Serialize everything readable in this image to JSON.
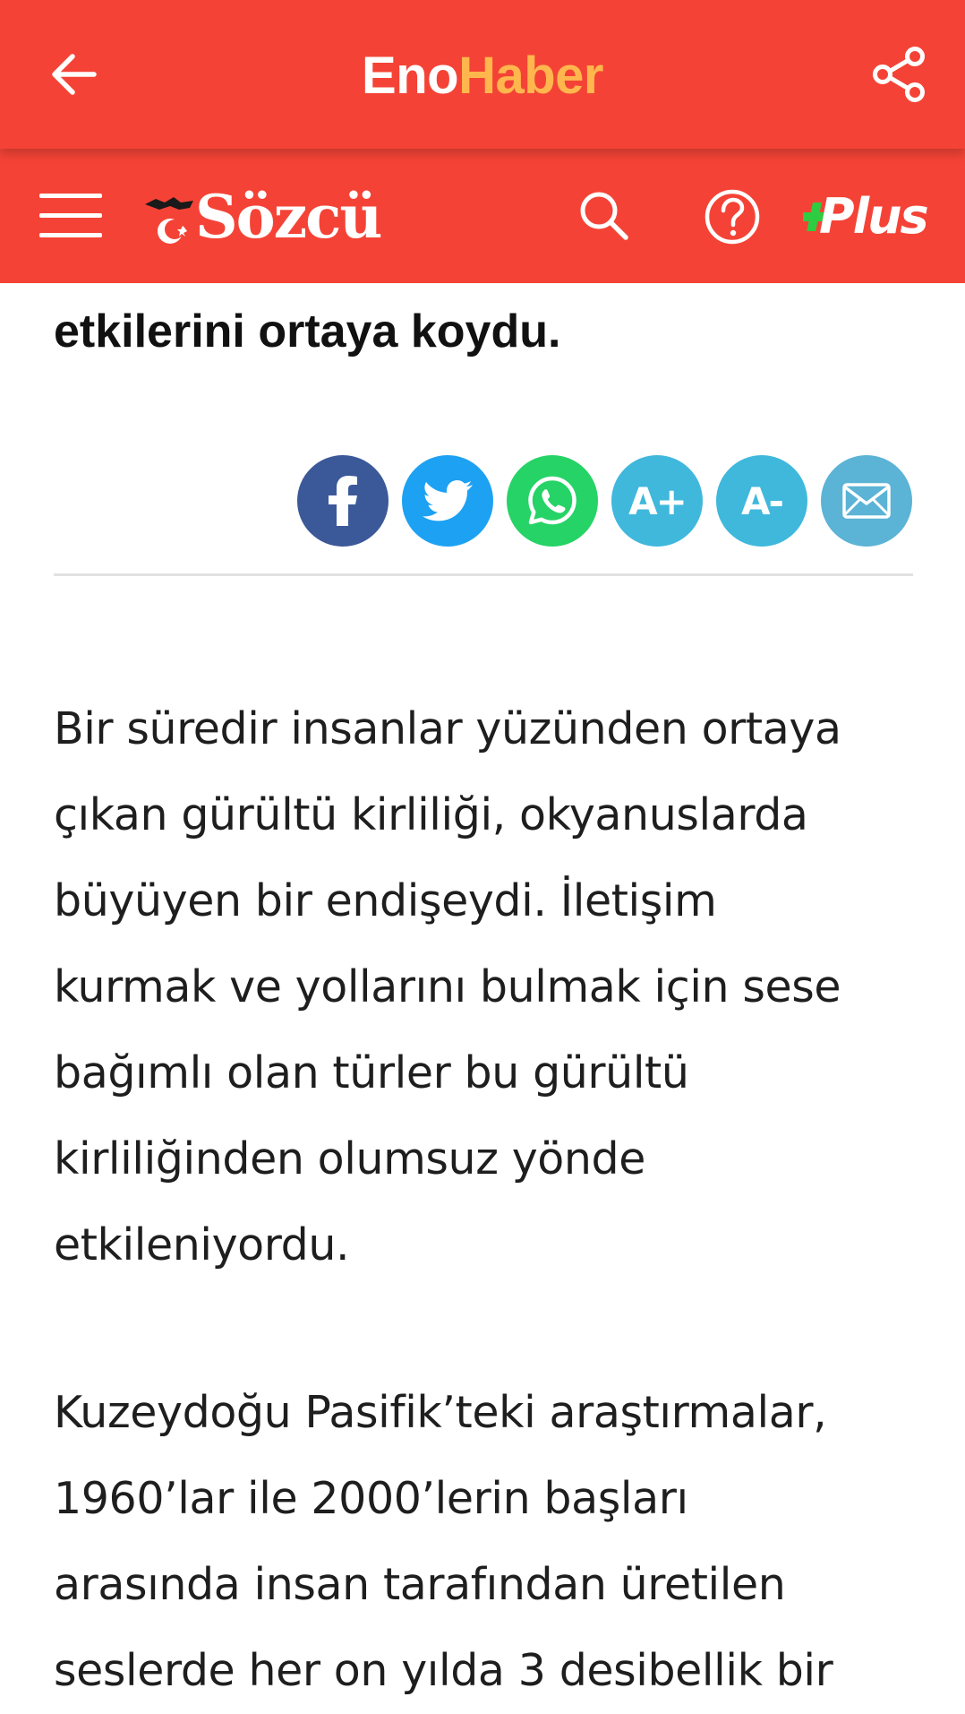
{
  "app_bar": {
    "title_part1": "Eno",
    "title_part2": "Haber",
    "back_icon": "arrow-left-icon",
    "share_icon": "share-icon"
  },
  "site_header": {
    "logo_text": "Sözcü",
    "menu_icon": "hamburger-menu-icon",
    "search_icon": "search-icon",
    "help_icon": "help-circle-icon",
    "plus_label": "Plus"
  },
  "article": {
    "headline_tail": "etkilerini ortaya koydu.",
    "share_buttons": {
      "facebook_icon": "facebook-icon",
      "twitter_icon": "twitter-icon",
      "whatsapp_icon": "whatsapp-icon",
      "font_increase_label": "A+",
      "font_decrease_label": "A-",
      "email_icon": "email-icon"
    },
    "paragraph_1_lines": [
      "Bir süredir insanlar yüzünden ortaya",
      "çıkan gürültü kirliliği, okyanuslarda",
      "büyüyen bir endişeydi. İletişim",
      "kurmak ve yollarını bulmak için sese",
      "bağımlı olan türler bu gürültü",
      "kirliliğinden olumsuz yönde",
      "etkileniyordu."
    ],
    "paragraph_2_lines": [
      "Kuzeydoğu Pasifik’teki araştırmalar,",
      "1960’lar ile 2000’lerin başları",
      "arasında insan tarafından üretilen",
      "seslerde her on yılda 3 desibellik bir"
    ]
  },
  "colors": {
    "brand_red": "#f44336",
    "accent_orange": "#ffb74d",
    "facebook": "#3b5998",
    "twitter": "#1da1f2",
    "whatsapp": "#25d366",
    "font_buttons": "#3fb8dc",
    "email": "#5bb3d6",
    "plus_green": "#2ecc40"
  }
}
